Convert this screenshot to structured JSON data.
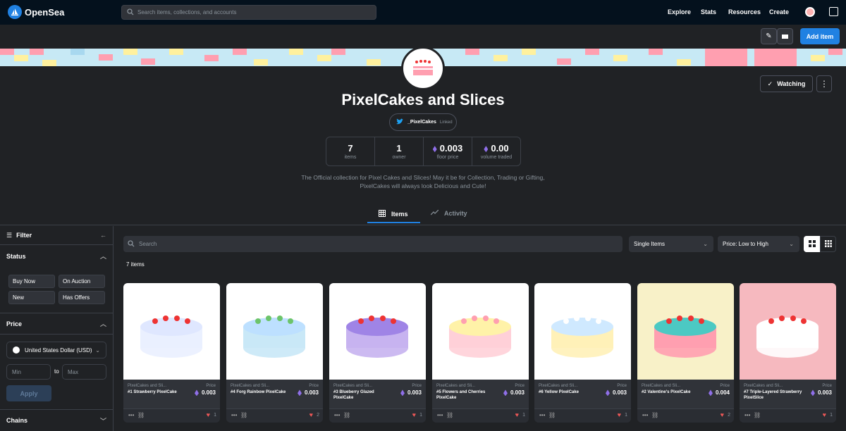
{
  "topbar": {
    "brand": "OpenSea",
    "search_placeholder": "Search items, collections, and accounts",
    "nav": [
      "Explore",
      "Stats",
      "Resources",
      "Create"
    ]
  },
  "toolbar": {
    "add_item": "Add item"
  },
  "collection": {
    "title": "PixelCakes and Slices",
    "twitter_handle": "_PixelCakes",
    "twitter_status": "Linked",
    "watch_label": "Watching",
    "stats": [
      {
        "value": "7",
        "label": "items",
        "eth": false
      },
      {
        "value": "1",
        "label": "owner",
        "eth": false
      },
      {
        "value": "0.003",
        "label": "floor price",
        "eth": true
      },
      {
        "value": "0.00",
        "label": "volume traded",
        "eth": true
      }
    ],
    "description_line1": "The Official collection for Pixel Cakes and Slices! May it be for Collection, Trading or Gifting,",
    "description_line2": "PixelCakes will always look Delicious and Cute!"
  },
  "tabs": {
    "items": "Items",
    "activity": "Activity"
  },
  "filter": {
    "title": "Filter",
    "status_title": "Status",
    "status_options": [
      "Buy Now",
      "On Auction",
      "New",
      "Has Offers"
    ],
    "price_title": "Price",
    "currency": "United States Dollar (USD)",
    "min_placeholder": "Min",
    "to": "to",
    "max_placeholder": "Max",
    "apply": "Apply",
    "chains_title": "Chains"
  },
  "main": {
    "search_placeholder": "Search",
    "type_select": "Single Items",
    "sort_select": "Price: Low to High",
    "item_count": "7 items"
  },
  "cards": [
    {
      "collection": "PixelCakes and Sli...",
      "name": "#1 Strawberry PixelCake",
      "price_label": "Price",
      "price": "0.003",
      "likes": "1"
    },
    {
      "collection": "PixelCakes and Sli...",
      "name": "#4 Forg Rainbow PixelCake",
      "price_label": "Price",
      "price": "0.003",
      "likes": "2"
    },
    {
      "collection": "PixelCakes and Sli...",
      "name": "#3 Blueberry Glazed PixelCake",
      "price_label": "Price",
      "price": "0.003",
      "likes": "1"
    },
    {
      "collection": "PixelCakes and Sli...",
      "name": "#5 Flowers and Cherries PixelCake",
      "price_label": "Price",
      "price": "0.003",
      "likes": "1"
    },
    {
      "collection": "PixelCakes and Sli...",
      "name": "#6 Yellow PixelCake",
      "price_label": "Price",
      "price": "0.003",
      "likes": "1"
    },
    {
      "collection": "PixelCakes and Sli...",
      "name": "#2 Valentine's PixelCake",
      "price_label": "Price",
      "price": "0.004",
      "likes": "2"
    },
    {
      "collection": "PixelCakes and Sli...",
      "name": "#7 Triple-Layered Strawberry PixelSlice",
      "price_label": "Price",
      "price": "0.003",
      "likes": "1"
    }
  ],
  "colors": {
    "accent": "#2081e2",
    "eth": "#8f6fe8",
    "heart": "#eb5757"
  }
}
